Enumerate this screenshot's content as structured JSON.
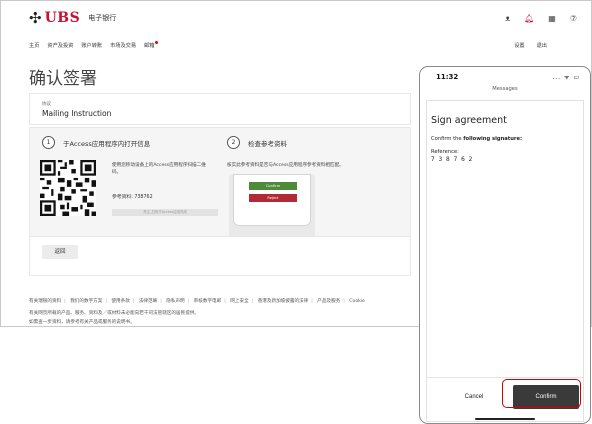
{
  "header": {
    "brand": "UBS",
    "subtitle": "电子银行",
    "icons": [
      "user-icon",
      "bell-icon",
      "grid-icon",
      "help-icon"
    ]
  },
  "nav": {
    "items": [
      "主页",
      "资产及投资",
      "账户转账",
      "市场及交易",
      "邮箱"
    ],
    "right": [
      "设置",
      "退出"
    ]
  },
  "page_title": "确认签署",
  "instruction": {
    "small_label": "协议",
    "value": "Mailing Instruction"
  },
  "steps": [
    {
      "num": "1",
      "label": "于Access应用程序内打开信息"
    },
    {
      "num": "2",
      "label": "检查参考资料"
    }
  ],
  "qr": {
    "instruction": "使用您移动设备上的Access应用程序扫描二维码。",
    "reference": "参考资料: 738762",
    "bar_text": "关注_扫码于Access应用完成"
  },
  "check": {
    "instruction": "核实此参考资料是否与Access应用程序参考资料相匹配。",
    "confirm": "Confirm",
    "reject": "Reject"
  },
  "back_button": "返回",
  "footer": {
    "links": [
      "有关瑞银的资料",
      "我们的数字方案",
      "使用条款",
      "法律范畴",
      "隐私声明",
      "审核数字电邮",
      "网上安全",
      "香港及新加坡披露的法律",
      "产品及服务",
      "Cookie"
    ],
    "notice_line1": "有关网页所载的产品、服务、资料及／或材料未必能向若干司法管辖区的居民提供。",
    "notice_line2": "如需查一步资料，请参考有关产品或服务的说明书。"
  },
  "phone": {
    "time": "11:32",
    "status_right": "... ᯤ ▭",
    "app": "Messages",
    "title": "Sign agreement",
    "confirm_prefix": "Confirm the ",
    "confirm_bold": "following signature:",
    "reference_label": "Reference:",
    "reference_value": "7 3 8 7 6 2",
    "cancel": "Cancel",
    "confirm": "Confirm"
  },
  "colors": {
    "brand_red": "#c8102e",
    "confirm_green": "#4d8b3b",
    "reject_red": "#b12a36",
    "phone_confirm": "#3a3a3a",
    "highlight": "#d20000"
  }
}
